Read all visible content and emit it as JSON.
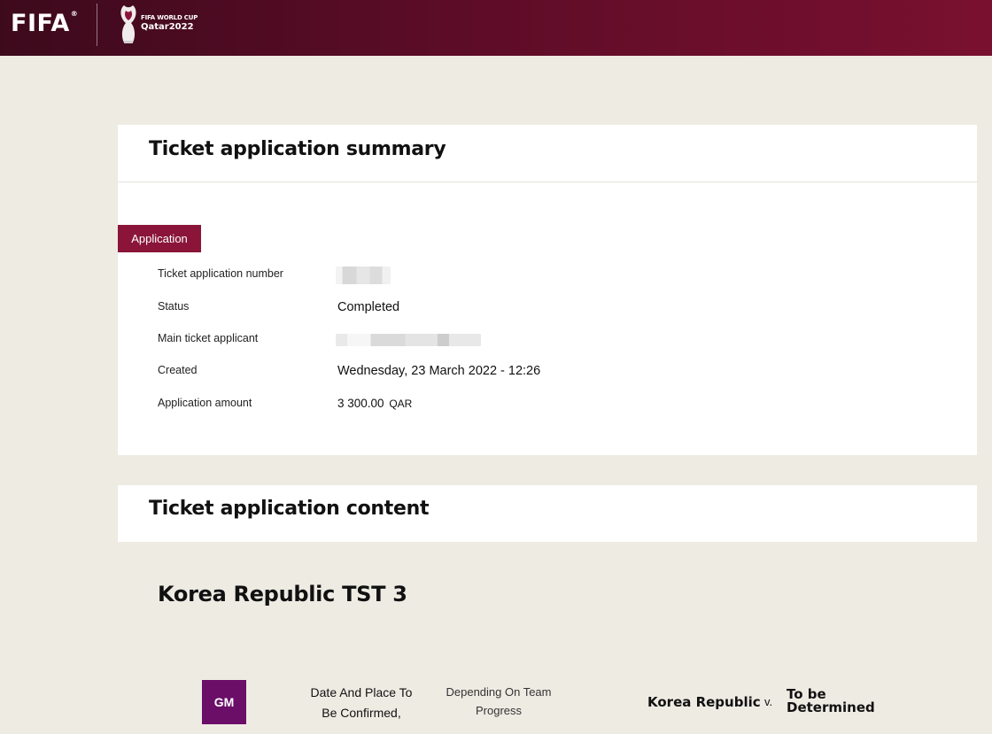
{
  "header": {
    "fifa_logo": "FIFA",
    "fifa_reg": "®",
    "event_line1": "FIFA WORLD CUP",
    "event_line2": "Qatar2022"
  },
  "summary": {
    "title": "Ticket application summary",
    "section_tag": "Application",
    "rows": [
      {
        "label": "Ticket application number",
        "value": ""
      },
      {
        "label": "Status",
        "value": "Completed"
      },
      {
        "label": "Main ticket applicant",
        "value": ""
      },
      {
        "label": "Created",
        "value": "Wednesday, 23 March 2022 - 12:26"
      },
      {
        "label": "Application amount",
        "value": "3 300.00",
        "currency": "QAR"
      }
    ]
  },
  "content": {
    "title": "Ticket application content",
    "match": {
      "title": "Korea Republic TST 3",
      "badge": "GM",
      "date_place_line1": "Date And Place To",
      "date_place_line2": "Be Confirmed,",
      "progress_line1": "Depending On Team",
      "progress_line2": "Progress",
      "team_home": "Korea Republic",
      "versus": "v.",
      "team_away": "To be Determined"
    }
  },
  "colors": {
    "brand": "#8a1538",
    "header_start": "#3d0a1c",
    "header_end": "#7a1030",
    "badge": "#6a0e68",
    "background": "#eeebe3"
  }
}
